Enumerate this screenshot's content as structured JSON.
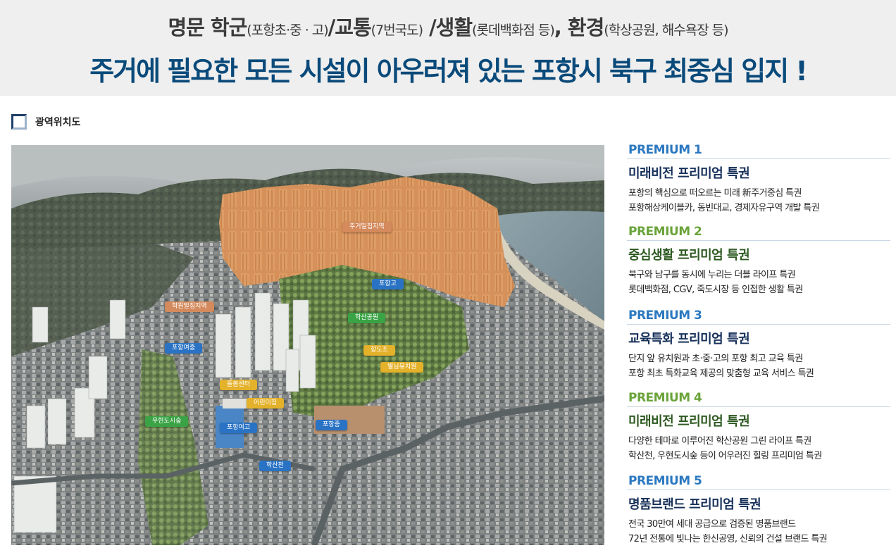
{
  "hero": {
    "line1": [
      {
        "text": "명문 학군",
        "small": false
      },
      {
        "text": "(포항초·중 · 고)",
        "small": true
      },
      {
        "text": "/교통",
        "small": false
      },
      {
        "text": "(7번국도)",
        "small": true
      },
      {
        "text": " /생활",
        "small": false
      },
      {
        "text": "(롯데백화점 등)",
        "small": true
      },
      {
        "text": ", 환경",
        "small": false
      },
      {
        "text": "(학상공원, 해수욕장 등)",
        "small": true
      }
    ],
    "line2": "주거에 필요한 모든 시설이 아우러져 있는 포항시 북구 최중심 입지 !"
  },
  "section": {
    "title": "광역위치도"
  },
  "map_labels": [
    {
      "id": "residential",
      "text": "주거밀집지역",
      "color": "orange"
    },
    {
      "id": "academy",
      "text": "학원밀집지역",
      "color": "orange"
    },
    {
      "id": "pohang-high",
      "text": "포항고",
      "color": "blue"
    },
    {
      "id": "haksan-park",
      "text": "학산공원",
      "color": "green"
    },
    {
      "id": "pohang-girls-middle",
      "text": "포항여중",
      "color": "blue"
    },
    {
      "id": "hangdo-elem",
      "text": "항도초",
      "color": "yellow"
    },
    {
      "id": "kindergarten",
      "text": "별님유치원",
      "color": "yellow"
    },
    {
      "id": "community",
      "text": "돌봄센터",
      "color": "yellow"
    },
    {
      "id": "daycare",
      "text": "어린이집",
      "color": "yellow"
    },
    {
      "id": "uhyeondo-forest",
      "text": "우현도시숲",
      "color": "green"
    },
    {
      "id": "pohang-girls-high",
      "text": "포항여고",
      "color": "blue"
    },
    {
      "id": "pohang-middle",
      "text": "포항중",
      "color": "blue"
    },
    {
      "id": "haksancheon",
      "text": "학산천",
      "color": "blue"
    }
  ],
  "premiums": [
    {
      "label": "PREMIUM 1",
      "title": "미래비전 프리미엄 특권",
      "lines": [
        "포항의 핵심으로 떠오르는 미래 新주거중심 특권",
        "포항해상케이블카, 동빈대교, 경제자유구역 개발 특권"
      ],
      "theme": "blue"
    },
    {
      "label": "PREMIUM 2",
      "title": "중심생활 프리미엄 특권",
      "lines": [
        "북구와 남구를 동시에 누리는 더블 라이프 특권",
        "롯데백화점, CGV, 죽도시장 등 인접한 생활 특권"
      ],
      "theme": "green"
    },
    {
      "label": "PREMIUM 3",
      "title": "교육특화 프리미엄 특권",
      "lines": [
        "단지 앞 유치원과 초·중·고의 포항 최고 교육 특권",
        "포항 최초 특화교육 제공의 맞춤형 교육 서비스 특권"
      ],
      "theme": "blue"
    },
    {
      "label": "PREMIUM 4",
      "title": "미래비전 프리미엄 특권",
      "lines": [
        "다양한 테마로 이루어진 학산공원 그린 라이프 특권",
        "학산천, 우현도시숲 등이 어우러진 힐링 프리미엄 특권"
      ],
      "theme": "green"
    },
    {
      "label": "PREMIUM 5",
      "title": "명품브랜드 프리미엄 특권",
      "lines": [
        "전국 30만여 세대 공급으로 검증된 명품브랜드",
        "72년 전통에 빛나는 한신공영, 신뢰의 건설 브랜드 특권"
      ],
      "theme": "blue"
    }
  ]
}
